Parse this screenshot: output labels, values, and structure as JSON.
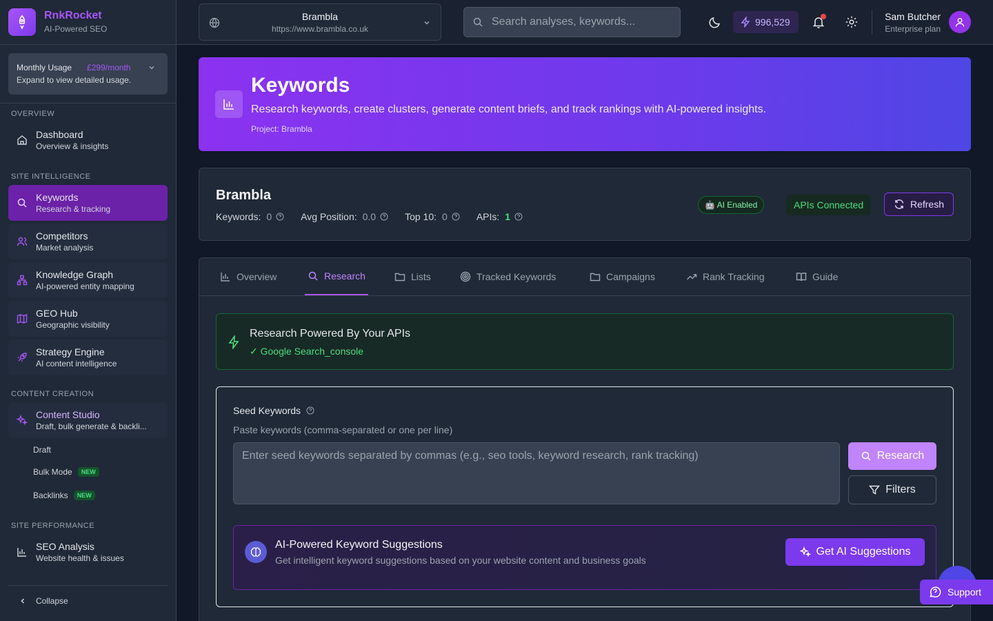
{
  "brand": {
    "name": "RnkRocket",
    "tagline": "AI-Powered SEO"
  },
  "usage": {
    "title": "Monthly Usage",
    "price": "£299/month",
    "subtitle": "Expand to view detailed usage."
  },
  "sidebar": {
    "sections": {
      "overview": "OVERVIEW",
      "site_intelligence": "SITE INTELLIGENCE",
      "content_creation": "CONTENT CREATION",
      "site_performance": "SITE PERFORMANCE"
    },
    "items": [
      {
        "title": "Dashboard",
        "subtitle": "Overview & insights",
        "icon": "home-icon"
      },
      {
        "title": "Keywords",
        "subtitle": "Research & tracking",
        "icon": "search-icon",
        "active": true
      },
      {
        "title": "Competitors",
        "subtitle": "Market analysis",
        "icon": "users-icon"
      },
      {
        "title": "Knowledge Graph",
        "subtitle": "AI-powered entity mapping",
        "icon": "network-icon"
      },
      {
        "title": "GEO Hub",
        "subtitle": "Geographic visibility",
        "icon": "map-icon"
      },
      {
        "title": "Strategy Engine",
        "subtitle": "AI content intelligence",
        "icon": "rocket-icon"
      },
      {
        "title": "Content Studio",
        "subtitle": "Draft, bulk generate & backli...",
        "icon": "sparkles-icon"
      },
      {
        "title": "SEO Analysis",
        "subtitle": "Website health & issues",
        "icon": "bar-chart-icon"
      }
    ],
    "sub_items": [
      {
        "label": "Draft",
        "badge": ""
      },
      {
        "label": "Bulk Mode",
        "badge": "NEW"
      },
      {
        "label": "Backlinks",
        "badge": "NEW"
      }
    ],
    "collapse_label": "Collapse"
  },
  "topbar": {
    "site_name": "Brambla",
    "site_url": "https://www.brambla.co.uk",
    "search_placeholder": "Search analyses, keywords...",
    "credits": "996,529",
    "user_name": "Sam Butcher",
    "user_plan": "Enterprise plan"
  },
  "hero": {
    "title": "Keywords",
    "description": "Research keywords, create clusters, generate content briefs, and track rankings with AI-powered insights.",
    "project": "Project: Brambla"
  },
  "project_card": {
    "name": "Brambla",
    "stats": [
      {
        "label": "Keywords:",
        "value": "0"
      },
      {
        "label": "Avg Position:",
        "value": "0.0"
      },
      {
        "label": "Top 10:",
        "value": "0"
      },
      {
        "label": "APIs:",
        "value": "1"
      }
    ],
    "ai_badge": "🤖 AI Enabled",
    "api_badge": "APIs Connected",
    "refresh_label": "Refresh"
  },
  "tabs": [
    {
      "label": "Overview",
      "icon": "bar-chart-icon"
    },
    {
      "label": "Research",
      "icon": "search-icon",
      "active": true
    },
    {
      "label": "Lists",
      "icon": "folder-icon"
    },
    {
      "label": "Tracked Keywords",
      "icon": "target-icon"
    },
    {
      "label": "Campaigns",
      "icon": "folder-icon"
    },
    {
      "label": "Rank Tracking",
      "icon": "trending-up-icon"
    },
    {
      "label": "Guide",
      "icon": "book-icon"
    }
  ],
  "api_card": {
    "title": "Research Powered By Your APIs",
    "source": "✓ Google Search_console"
  },
  "seed": {
    "label": "Seed Keywords",
    "help": "Paste keywords (comma-separated or one per line)",
    "placeholder": "Enter seed keywords separated by commas (e.g., seo tools, keyword research, rank tracking)",
    "research_label": "Research",
    "filters_label": "Filters"
  },
  "ai_suggest": {
    "title": "AI-Powered Keyword Suggestions",
    "description": "Get intelligent keyword suggestions based on your website content and business goals",
    "button_label": "Get AI Suggestions"
  },
  "support_label": "Support",
  "colors": {
    "accent": "#a855f7",
    "success": "#4ade80",
    "background": "#111827",
    "surface": "#1f2937"
  }
}
